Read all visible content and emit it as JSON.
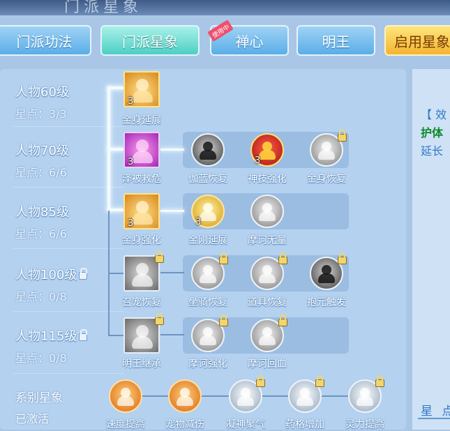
{
  "header": {
    "title": "门派星象"
  },
  "tabs": [
    {
      "label": "门派功法"
    },
    {
      "label": "门派星象"
    },
    {
      "label": "禅心",
      "badge": "使用中"
    },
    {
      "label": "明王"
    },
    {
      "label": "启用星象"
    }
  ],
  "levels": [
    {
      "level": "人物60级",
      "points": "星点：3/3"
    },
    {
      "level": "人物70级",
      "points": "星点：6/6"
    },
    {
      "level": "人物85级",
      "points": "星点：6/6"
    },
    {
      "level": "人物100级",
      "points": "星点：0/8"
    },
    {
      "level": "人物115级",
      "points": "星点：0/8"
    }
  ],
  "skills": {
    "r1": [
      {
        "name": "金身延展",
        "count": "3"
      }
    ],
    "r2": [
      {
        "name": "泽被救危",
        "count": "3"
      },
      {
        "name": "伽蓝恢复"
      },
      {
        "name": "神技强化",
        "count": "3"
      },
      {
        "name": "金身恢复"
      }
    ],
    "r3": [
      {
        "name": "金身强化",
        "count": "3"
      },
      {
        "name": "金刚延展",
        "count": "3"
      },
      {
        "name": "摩诃无量"
      }
    ],
    "r4": [
      {
        "name": "召宠恢复"
      },
      {
        "name": "坐骑恢复"
      },
      {
        "name": "道具恢复"
      },
      {
        "name": "抱元触发"
      }
    ],
    "r5": [
      {
        "name": "明王继承"
      },
      {
        "name": "摩诃强化"
      },
      {
        "name": "摩诃回血"
      }
    ]
  },
  "footer": {
    "title": "系别星象",
    "status": "已激活",
    "items": [
      {
        "name": "速度提高"
      },
      {
        "name": "宠物减伤"
      },
      {
        "name": "凝神聚气"
      },
      {
        "name": "药格增加"
      },
      {
        "name": "灵力提高"
      }
    ]
  },
  "right_panel": {
    "effect": "【 效",
    "effect_name": "护体",
    "desc": "延长",
    "star_label": "星 点"
  }
}
